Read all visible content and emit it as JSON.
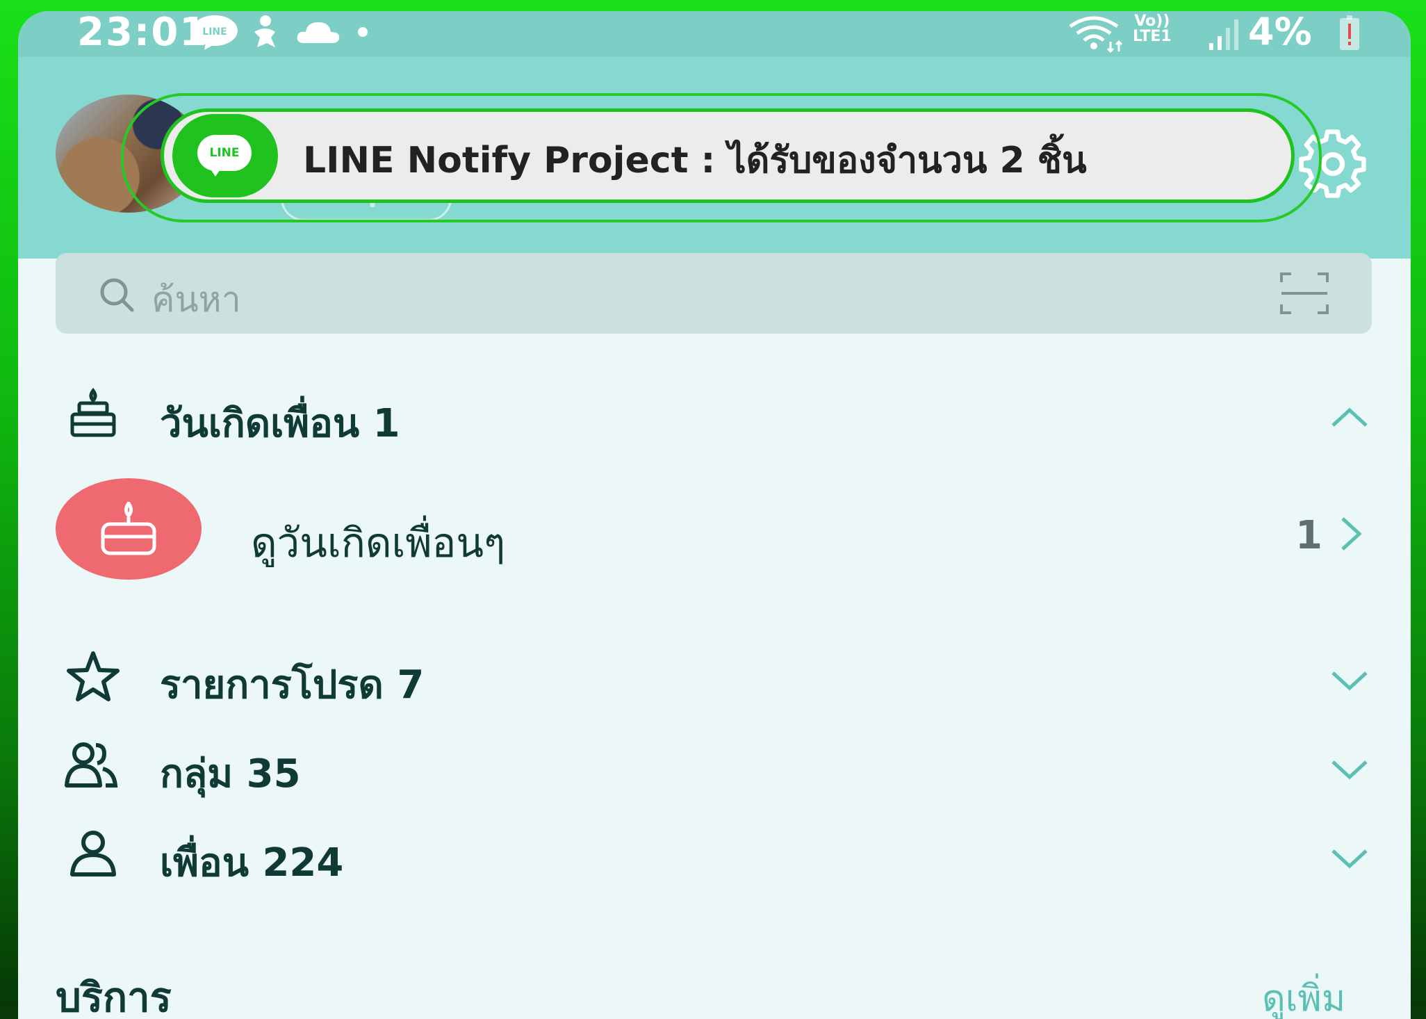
{
  "status_bar": {
    "time": "23:01",
    "net_top": "Vo))",
    "net_bottom": "LTE1",
    "battery": "4%"
  },
  "header": {
    "keep_label": "Keep"
  },
  "notification": {
    "logo_text": "LINE",
    "message": "LINE Notify  Project : ได้รับของจำนวน  2 ชิ้น"
  },
  "search": {
    "placeholder": "ค้นหา"
  },
  "sections": {
    "birthdays": {
      "label": "วันเกิดเพื่อน 1",
      "expanded": true
    },
    "favorites": {
      "label": "รายการโปรด 7",
      "expanded": false
    },
    "groups": {
      "label": "กลุ่ม 35",
      "expanded": false
    },
    "friends": {
      "label": "เพื่อน 224",
      "expanded": false
    }
  },
  "birthday_item": {
    "label": "ดูวันเกิดเพื่อนๆ",
    "count": "1"
  },
  "services": {
    "title": "บริการ",
    "see_more": "ดูเพิ่ม"
  },
  "colors": {
    "header_bg": "#86d9d0",
    "line_green": "#1fc21f",
    "bday_red": "#ef6970",
    "text_dark": "#0f3a35"
  }
}
